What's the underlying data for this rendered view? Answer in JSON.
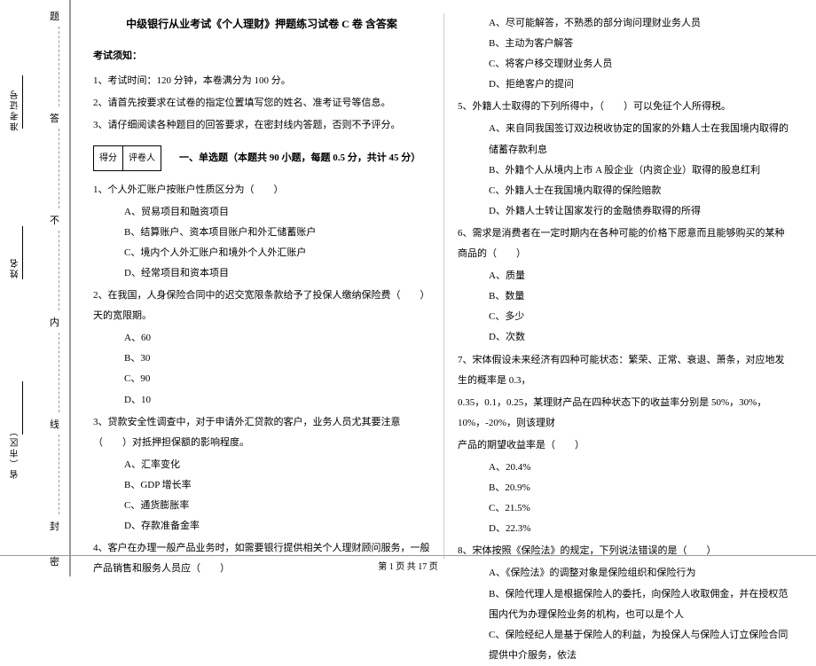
{
  "binding": {
    "labels": [
      "准考证号",
      "姓名",
      "省（市区）"
    ],
    "seal_chars": [
      "题",
      "答",
      "不",
      "内",
      "线",
      "封",
      "密"
    ]
  },
  "title": "中级银行从业考试《个人理财》押题练习试卷 C 卷 含答案",
  "notice_head": "考试须知：",
  "notices": [
    "1、考试时间：120 分钟，本卷满分为 100 分。",
    "2、请首先按要求在试卷的指定位置填写您的姓名、准考证号等信息。",
    "3、请仔细阅读各种题目的回答要求，在密封线内答题，否则不予评分。"
  ],
  "score_labels": {
    "h1": "得分",
    "h2": "评卷人"
  },
  "section1": "一、单选题（本题共 90 小题，每题 0.5 分，共计 45 分）",
  "q1": {
    "stem": "1、个人外汇账户按账户性质区分为（　　）",
    "opts": [
      "A、贸易项目和融资项目",
      "B、结算账户、资本项目账户和外汇储蓄账户",
      "C、境内个人外汇账户和境外个人外汇账户",
      "D、经常项目和资本项目"
    ]
  },
  "q2": {
    "stem": "2、在我国，人身保险合同中的迟交宽限条款给予了投保人缴纳保险费（　　）天的宽限期。",
    "opts": [
      "A、60",
      "B、30",
      "C、90",
      "D、10"
    ]
  },
  "q3": {
    "stem": "3、贷款安全性调查中，对于申请外汇贷款的客户，业务人员尤其要注意（　　）对抵押担保额的影响程度。",
    "opts": [
      "A、汇率变化",
      "B、GDP 增长率",
      "C、通货膨胀率",
      "D、存款准备金率"
    ]
  },
  "q4": {
    "stem": "4、客户在办理一般产品业务时，如需要银行提供相关个人理财顾问服务，一般产品销售和服务人员应（　　）",
    "opts": [
      "A、尽可能解答，不熟悉的部分询问理财业务人员",
      "B、主动为客户解答",
      "C、将客户移交理财业务人员",
      "D、拒绝客户的提问"
    ]
  },
  "q5": {
    "stem": "5、外籍人士取得的下列所得中，（　　）可以免征个人所得税。",
    "opts": [
      "A、来自同我国签订双边税收协定的国家的外籍人士在我国境内取得的储蓄存款利息",
      "B、外籍个人从境内上市 A 股企业（内资企业）取得的股息红利",
      "C、外籍人士在我国境内取得的保险赔款",
      "D、外籍人士转让国家发行的金融债券取得的所得"
    ]
  },
  "q6": {
    "stem": "6、需求是消费者在一定时期内在各种可能的价格下愿意而且能够购买的某种商品的（　　）",
    "opts": [
      "A、质量",
      "B、数量",
      "C、多少",
      "D、次数"
    ]
  },
  "q7": {
    "stem_l1": "7、宋体假设未来经济有四种可能状态：繁荣、正常、衰退、萧条，对应地发生的概率是 0.3，",
    "stem_l2": "0.35，0.1，0.25，某理财产品在四种状态下的收益率分别是 50%，30%，10%，-20%，则该理财",
    "stem_l3": "产品的期望收益率是（　　）",
    "opts": [
      "A、20.4%",
      "B、20.9%",
      "C、21.5%",
      "D、22.3%"
    ]
  },
  "q8": {
    "stem": "8、宋体按照《保险法》的规定，下列说法错误的是（　　）",
    "opts": [
      "A、《保险法》的调整对象是保险组织和保险行为",
      "B、保险代理人是根据保险人的委托，向保险人收取佣金，并在授权范围内代为办理保险业务的机构，也可以是个人",
      "C、保险经纪人是基于保险人的利益，为投保人与保险人订立保险合同提供中介服务，依法"
    ]
  },
  "footer": "第 1 页 共 17 页"
}
